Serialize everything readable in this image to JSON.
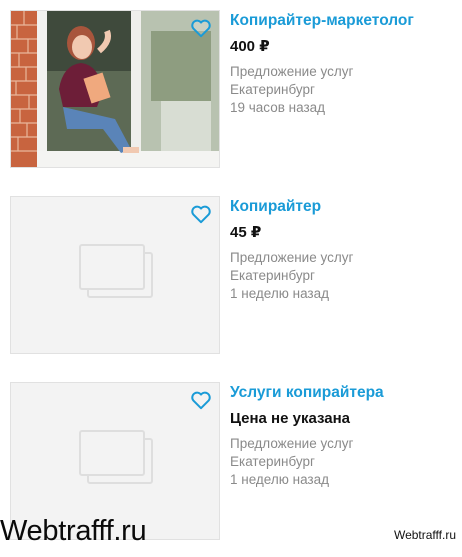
{
  "listings": [
    {
      "title": "Копирайтер-маркетолог",
      "price": "400 ₽",
      "category": "Предложение услуг",
      "city": "Екатеринбург",
      "time": "19 часов назад",
      "icon": "heart-outline-icon"
    },
    {
      "title": "Копирайтер",
      "price": "45 ₽",
      "category": "Предложение услуг",
      "city": "Екатеринбург",
      "time": "1 неделю назад",
      "icon": "heart-outline-icon"
    },
    {
      "title": "Услуги копирайтера",
      "price": "Цена не указана",
      "category": "Предложение услуг",
      "city": "Екатеринбург",
      "time": "1 неделю назад",
      "icon": "heart-outline-icon"
    }
  ],
  "watermark": {
    "left": "Webtrafff.ru",
    "right": "Webtrafff.ru"
  },
  "colors": {
    "accent": "#1a9bd7",
    "muted": "#8a8a8a"
  }
}
